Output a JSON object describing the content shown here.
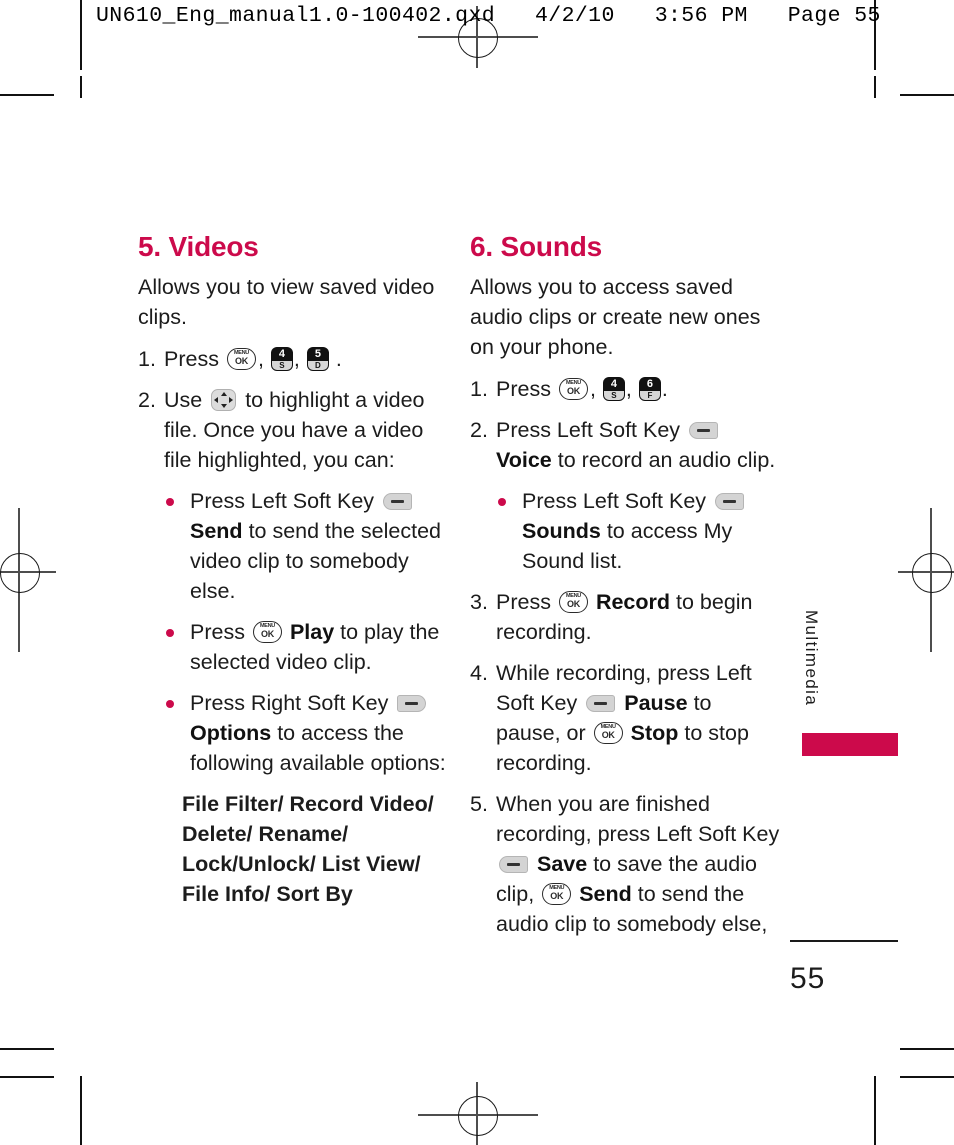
{
  "header": {
    "print_slug": "UN610_Eng_manual1.0-100402.qxd   4/2/10   3:56 PM   Page 55"
  },
  "side_tab": {
    "label": "Multimedia",
    "bar_color": "#cc0a4b"
  },
  "folio": {
    "page_number": "55"
  },
  "theme": {
    "heading_color": "#cc0a4b",
    "bullet_color": "#cc0a4b",
    "body_color": "#1c1c1c"
  },
  "keys": {
    "ok": {
      "top": "MENU",
      "bottom": "OK"
    },
    "num4": {
      "digit": "4",
      "letter": "S"
    },
    "num5": {
      "digit": "5",
      "letter": "D"
    },
    "num6": {
      "digit": "6",
      "letter": "F"
    }
  },
  "left_column": {
    "title": "5. Videos",
    "intro": "Allows you to view saved video clips.",
    "step1": {
      "number": "1.",
      "lead": "Press",
      "sep1": ",",
      "sep2": ",",
      "end": "."
    },
    "step2": {
      "number": "2.",
      "lead": "Use",
      "text": "to highlight a video file. Once you have a video file highlighted, you can:"
    },
    "bullets": [
      {
        "lead": "Press Left Soft Key",
        "softkey": "left",
        "bold": "Send",
        "tail": "to send the selected video clip to somebody else."
      },
      {
        "lead": "Press",
        "softkey": "ok",
        "bold": "Play",
        "tail": "to play the selected video clip."
      },
      {
        "lead": "Press Right Soft Key",
        "softkey": "right",
        "bold": "Options",
        "tail": "to access the following available options:"
      }
    ],
    "options_lines": [
      "File Filter/ Record Video/",
      "Delete/ Rename/",
      "Lock/Unlock/ List View/",
      "File Info/ Sort By"
    ]
  },
  "right_column": {
    "title": "6. Sounds",
    "intro": "Allows you to access saved audio clips or create new ones on your phone.",
    "step1": {
      "number": "1.",
      "lead": "Press",
      "sep1": ",",
      "sep2": ",",
      "end": "."
    },
    "step2": {
      "number": "2.",
      "lead": "Press Left Soft Key",
      "bold": "Voice",
      "tail": "to record an audio clip."
    },
    "bullet": {
      "lead": "Press Left Soft Key",
      "bold": "Sounds",
      "tail": "to access My Sound list."
    },
    "step3": {
      "number": "3.",
      "lead": "Press",
      "bold": "Record",
      "tail": "to begin recording."
    },
    "step4": {
      "number": "4.",
      "lead": "While recording, press Left Soft Key",
      "bold1": "Pause",
      "mid": "to pause, or",
      "bold2": "Stop",
      "tail": "to stop recording."
    },
    "step5": {
      "number": "5.",
      "lead": "When you are finished recording, press Left Soft Key",
      "bold1": "Save",
      "mid": "to save the audio clip,",
      "bold2": "Send",
      "tail": "to send the audio clip to somebody else,"
    }
  }
}
